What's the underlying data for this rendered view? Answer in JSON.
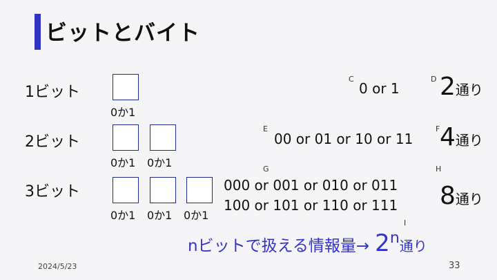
{
  "title": "ビットとバイト",
  "rows": [
    {
      "label": "1ビット",
      "captions": [
        "0か1"
      ],
      "tag_values": "C",
      "values": [
        "0 or 1"
      ],
      "tag_count": "D",
      "count": "2",
      "unit": "通り"
    },
    {
      "label": "2ビット",
      "captions": [
        "0か1",
        "0か1"
      ],
      "tag_values": "E",
      "values": [
        "00 or 01 or 10 or 11"
      ],
      "tag_count": "F",
      "count": "4",
      "unit": "通り"
    },
    {
      "label": "3ビット",
      "captions": [
        "0か1",
        "0か1",
        "0か1"
      ],
      "tag_values": "G",
      "values": [
        "000 or 001 or 010 or 011",
        "100 or 101 or 110 or 111"
      ],
      "tag_count": "H",
      "count": "8",
      "unit": "通り"
    }
  ],
  "nbits": {
    "text": "nビットで扱える情報量→",
    "tag": "I",
    "base": "2",
    "exponent": "n",
    "unit": "通り"
  },
  "footer": {
    "date": "2024/5/23",
    "page": "33"
  },
  "colors": {
    "accent": "#2f34c4",
    "nbits_text": "#3333c8",
    "box_border": "#1f2a8a"
  }
}
